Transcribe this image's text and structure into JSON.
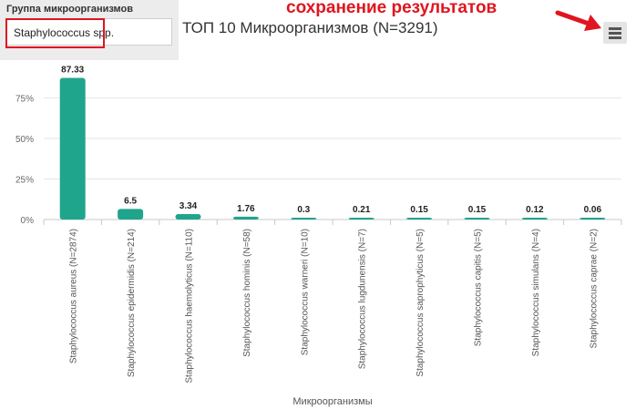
{
  "filter": {
    "label": "Группа микроорганизмов",
    "value": "Staphylococcus spp."
  },
  "annotation": {
    "text": "сохранение результатов",
    "color": "#e0151f"
  },
  "menu": {
    "icon": "hamburger-menu-icon"
  },
  "chart_data": {
    "type": "bar",
    "title": "ТОП 10 Микроорганизмов (N=3291)",
    "xlabel": "Микроорганизмы",
    "ylabel": "",
    "ylim": [
      0,
      100
    ],
    "yticks": [
      "0%",
      "25%",
      "50%",
      "75%"
    ],
    "grid": true,
    "bar_color": "#20a58d",
    "categories": [
      "Staphylococcus aureus (N=2874)",
      "Staphylococcus epidermidis (N=214)",
      "Staphylococcus haemolyticus (N=110)",
      "Staphylococcus hominis (N=58)",
      "Staphylococcus warneri (N=10)",
      "Staphylococcus lugdunensis (N=7)",
      "Staphylococcus saprophyticus (N=5)",
      "Staphylococcus capitis (N=5)",
      "Staphylococcus simulans (N=4)",
      "Staphylococcus caprae (N=2)"
    ],
    "values": [
      87.33,
      6.5,
      3.34,
      1.76,
      0.3,
      0.21,
      0.15,
      0.15,
      0.12,
      0.06
    ],
    "data_labels": [
      "87.33",
      "6.5",
      "3.34",
      "1.76",
      "0.3",
      "0.21",
      "0.15",
      "0.15",
      "0.12",
      "0.06"
    ]
  }
}
